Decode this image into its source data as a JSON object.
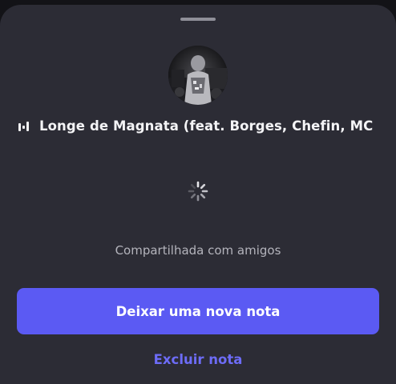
{
  "sheet": {
    "song_title": "Longe de Magnata (feat. Borges, Chefin, MC Lu",
    "status_text": "Compartilhada com amigos",
    "primary_button_label": "Deixar uma nova nota",
    "delete_button_label": "Excluir nota"
  },
  "icons": {
    "handle": "drag-handle",
    "eq": "audio-equalizer-icon",
    "spinner": "loading-spinner-icon"
  },
  "colors": {
    "sheet_background": "#2c2c35",
    "accent": "#5b5af3",
    "link": "#6d6cf7",
    "text_primary": "#f4f4f6",
    "text_secondary": "#b4b4bc"
  }
}
